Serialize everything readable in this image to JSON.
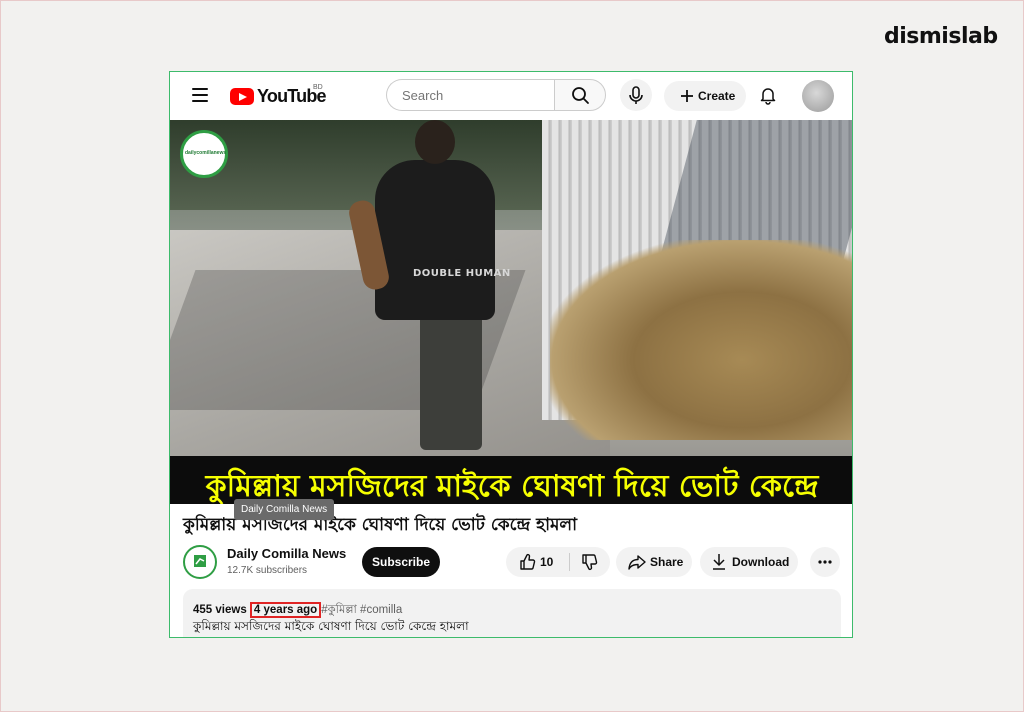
{
  "brand": {
    "logo_text": "dismislab"
  },
  "youtube": {
    "logo_text": "YouTube",
    "region": "BD",
    "search": {
      "placeholder": "Search"
    },
    "create_label": "Create"
  },
  "video": {
    "channel_badge_text": "dailycomillanews",
    "shirt_text": "DOUBLE HUMAN",
    "caption": "কুমিল্লায় মসজিদের মাইকে ঘোষণা দিয়ে ভোট কেন্দ্রে হামলা"
  },
  "meta": {
    "title": "কুমিল্লায় মসজিদের মাইকে ঘোষণা দিয়ে ভোট কেন্দ্রে হামলা",
    "tooltip": "Daily Comilla News",
    "channel_name": "Daily Comilla News",
    "subscribers": "12.7K subscribers",
    "subscribe_label": "Subscribe",
    "likes": "10",
    "share_label": "Share",
    "download_label": "Download"
  },
  "description": {
    "views": "455 views",
    "age": "4 years ago",
    "tags": "#কুমিল্লা #comilla",
    "text": "কুমিল্লায় মসজিদের মাইকে ঘোষণা দিয়ে ভোট কেন্দ্রে হামলা"
  },
  "colors": {
    "frame_border": "#3dbb6b",
    "highlight": "#e02424",
    "caption_text": "#f6ff00",
    "youtube_red": "#ff0000"
  }
}
